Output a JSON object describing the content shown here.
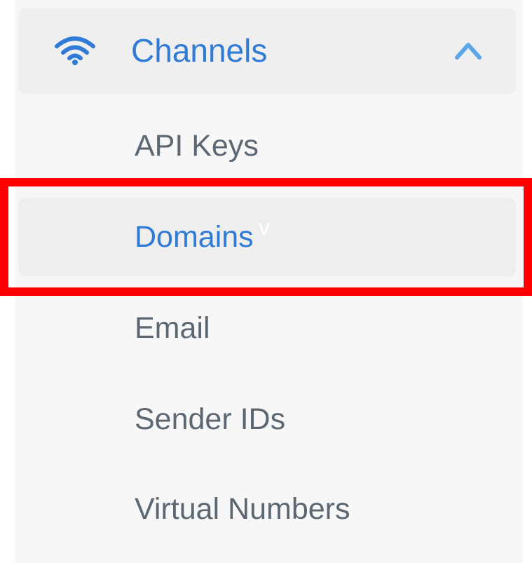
{
  "colors": {
    "accent": "#2f7bd6",
    "text_muted": "#5d6772",
    "highlight": "#ff0000"
  },
  "section": {
    "icon": "wifi-icon",
    "label": "Channels",
    "toggle_icon": "chevron-up-icon"
  },
  "items": [
    {
      "label": "API Keys",
      "active": false
    },
    {
      "label": "Domains",
      "active": true
    },
    {
      "label": "Email",
      "active": false
    },
    {
      "label": "Sender IDs",
      "active": false
    },
    {
      "label": "Virtual Numbers",
      "active": false
    }
  ],
  "cursor_glyph": "v"
}
